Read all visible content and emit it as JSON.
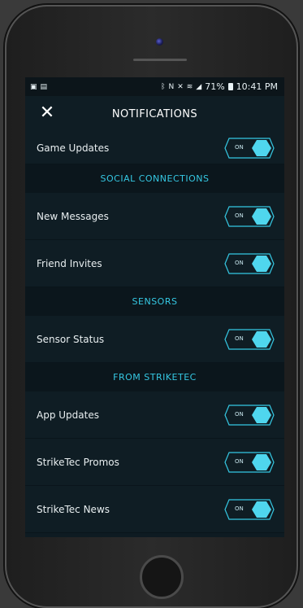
{
  "status_bar": {
    "left_icons": [
      "image-icon",
      "document-icon"
    ],
    "right_icons": [
      "bluetooth-icon",
      "nfc-icon",
      "mute-icon",
      "wifi-icon",
      "signal-icon"
    ],
    "battery": "71%",
    "time": "10:41 PM"
  },
  "header": {
    "title": "NOTIFICATIONS",
    "close_icon": "close-icon"
  },
  "game_updates": {
    "label": "Game Updates",
    "toggle": "ON"
  },
  "sections": {
    "social": "SOCIAL CONNECTIONS",
    "sensors": "SENSORS",
    "from": "FROM STRIKETEC"
  },
  "social_items": [
    {
      "label": "New Messages",
      "toggle": "ON"
    },
    {
      "label": "Friend Invites",
      "toggle": "ON"
    }
  ],
  "sensor_items": [
    {
      "label": "Sensor Status",
      "toggle": "ON"
    }
  ],
  "striketec_items": [
    {
      "label": "App Updates",
      "toggle": "ON"
    },
    {
      "label": "StrikeTec Promos",
      "toggle": "ON"
    },
    {
      "label": "StrikeTec News",
      "toggle": "ON"
    }
  ],
  "colors": {
    "accent": "#35c8e3",
    "knob": "#4fd6ee",
    "background": "#0f1d24",
    "section_bg": "#0b161c"
  }
}
